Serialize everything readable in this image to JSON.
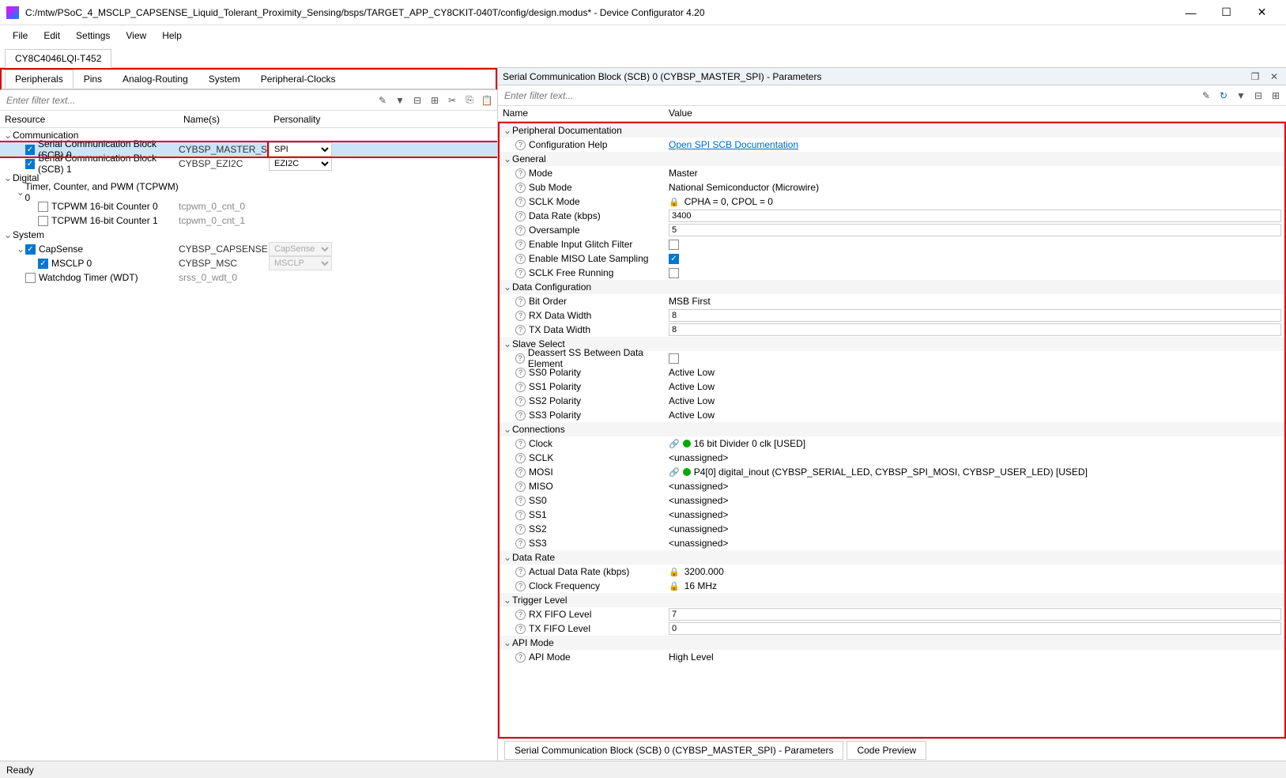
{
  "title": "C:/mtw/PSoC_4_MSCLP_CAPSENSE_Liquid_Tolerant_Proximity_Sensing/bsps/TARGET_APP_CY8CKIT-040T/config/design.modus* - Device Configurator 4.20",
  "menu": [
    "File",
    "Edit",
    "Settings",
    "View",
    "Help"
  ],
  "device_tab": "CY8C4046LQI-T452",
  "left_tabs": [
    "Peripherals",
    "Pins",
    "Analog-Routing",
    "System",
    "Peripheral-Clocks"
  ],
  "left_filter_placeholder": "Enter filter text...",
  "tree_headers": {
    "resource": "Resource",
    "names": "Name(s)",
    "personality": "Personality"
  },
  "tree": {
    "communication": {
      "label": "Communication",
      "scb0": {
        "label": "Serial Communication Block (SCB) 0",
        "name": "CYBSP_MASTER_SPI",
        "pers": "SPI"
      },
      "scb1": {
        "label": "Serial Communication Block (SCB) 1",
        "name": "CYBSP_EZI2C",
        "pers": "EZI2C"
      }
    },
    "digital": {
      "label": "Digital",
      "tcpwm": {
        "label": "Timer, Counter, and PWM (TCPWM) 0"
      },
      "cnt0": {
        "label": "TCPWM 16-bit Counter 0",
        "name": "tcpwm_0_cnt_0"
      },
      "cnt1": {
        "label": "TCPWM 16-bit Counter 1",
        "name": "tcpwm_0_cnt_1"
      }
    },
    "system": {
      "label": "System",
      "capsense": {
        "label": "CapSense",
        "name": "CYBSP_CAPSENSE",
        "pers": "CapSense"
      },
      "msclp": {
        "label": "MSCLP 0",
        "name": "CYBSP_MSC",
        "pers": "MSCLP"
      },
      "wdt": {
        "label": "Watchdog Timer (WDT)",
        "name": "srss_0_wdt_0"
      }
    }
  },
  "params_title": "Serial Communication Block (SCB) 0 (CYBSP_MASTER_SPI) - Parameters",
  "right_filter_placeholder": "Enter filter text...",
  "param_headers": {
    "name": "Name",
    "value": "Value"
  },
  "groups": {
    "doc": "Peripheral Documentation",
    "general": "General",
    "dataconfig": "Data Configuration",
    "slavesel": "Slave Select",
    "connections": "Connections",
    "datarate": "Data Rate",
    "trigger": "Trigger Level",
    "apimode": "API Mode"
  },
  "params": {
    "confighelp": {
      "name": "Configuration Help",
      "value": "Open SPI SCB Documentation"
    },
    "mode": {
      "name": "Mode",
      "value": "Master"
    },
    "submode": {
      "name": "Sub Mode",
      "value": "National Semiconductor (Microwire)"
    },
    "sclkmode": {
      "name": "SCLK Mode",
      "value": "CPHA = 0, CPOL = 0"
    },
    "datarate": {
      "name": "Data Rate (kbps)",
      "value": "3400"
    },
    "oversample": {
      "name": "Oversample",
      "value": "5"
    },
    "glitch": {
      "name": "Enable Input Glitch Filter"
    },
    "miso_late": {
      "name": "Enable MISO Late Sampling"
    },
    "sclkfree": {
      "name": "SCLK Free Running"
    },
    "bitorder": {
      "name": "Bit Order",
      "value": "MSB First"
    },
    "rxwidth": {
      "name": "RX Data Width",
      "value": "8"
    },
    "txwidth": {
      "name": "TX Data Width",
      "value": "8"
    },
    "deassert": {
      "name": "Deassert SS Between Data Element"
    },
    "ss0pol": {
      "name": "SS0 Polarity",
      "value": "Active Low"
    },
    "ss1pol": {
      "name": "SS1 Polarity",
      "value": "Active Low"
    },
    "ss2pol": {
      "name": "SS2 Polarity",
      "value": "Active Low"
    },
    "ss3pol": {
      "name": "SS3 Polarity",
      "value": "Active Low"
    },
    "clock": {
      "name": "Clock",
      "value": "16 bit Divider 0 clk [USED]"
    },
    "sclk": {
      "name": "SCLK",
      "value": "<unassigned>"
    },
    "mosi": {
      "name": "MOSI",
      "value": "P4[0] digital_inout (CYBSP_SERIAL_LED, CYBSP_SPI_MOSI, CYBSP_USER_LED) [USED]"
    },
    "miso": {
      "name": "MISO",
      "value": "<unassigned>"
    },
    "ss0": {
      "name": "SS0",
      "value": "<unassigned>"
    },
    "ss1": {
      "name": "SS1",
      "value": "<unassigned>"
    },
    "ss2": {
      "name": "SS2",
      "value": "<unassigned>"
    },
    "ss3": {
      "name": "SS3",
      "value": "<unassigned>"
    },
    "actualdr": {
      "name": "Actual Data Rate (kbps)",
      "value": "3200.000"
    },
    "clockfreq": {
      "name": "Clock Frequency",
      "value": "16 MHz"
    },
    "rxfifo": {
      "name": "RX FIFO Level",
      "value": "7"
    },
    "txfifo": {
      "name": "TX FIFO Level",
      "value": "0"
    },
    "apimode_p": {
      "name": "API Mode",
      "value": "High Level"
    }
  },
  "bottom_tabs": {
    "params": "Serial Communication Block (SCB) 0 (CYBSP_MASTER_SPI) - Parameters",
    "code": "Code Preview"
  },
  "status": "Ready"
}
